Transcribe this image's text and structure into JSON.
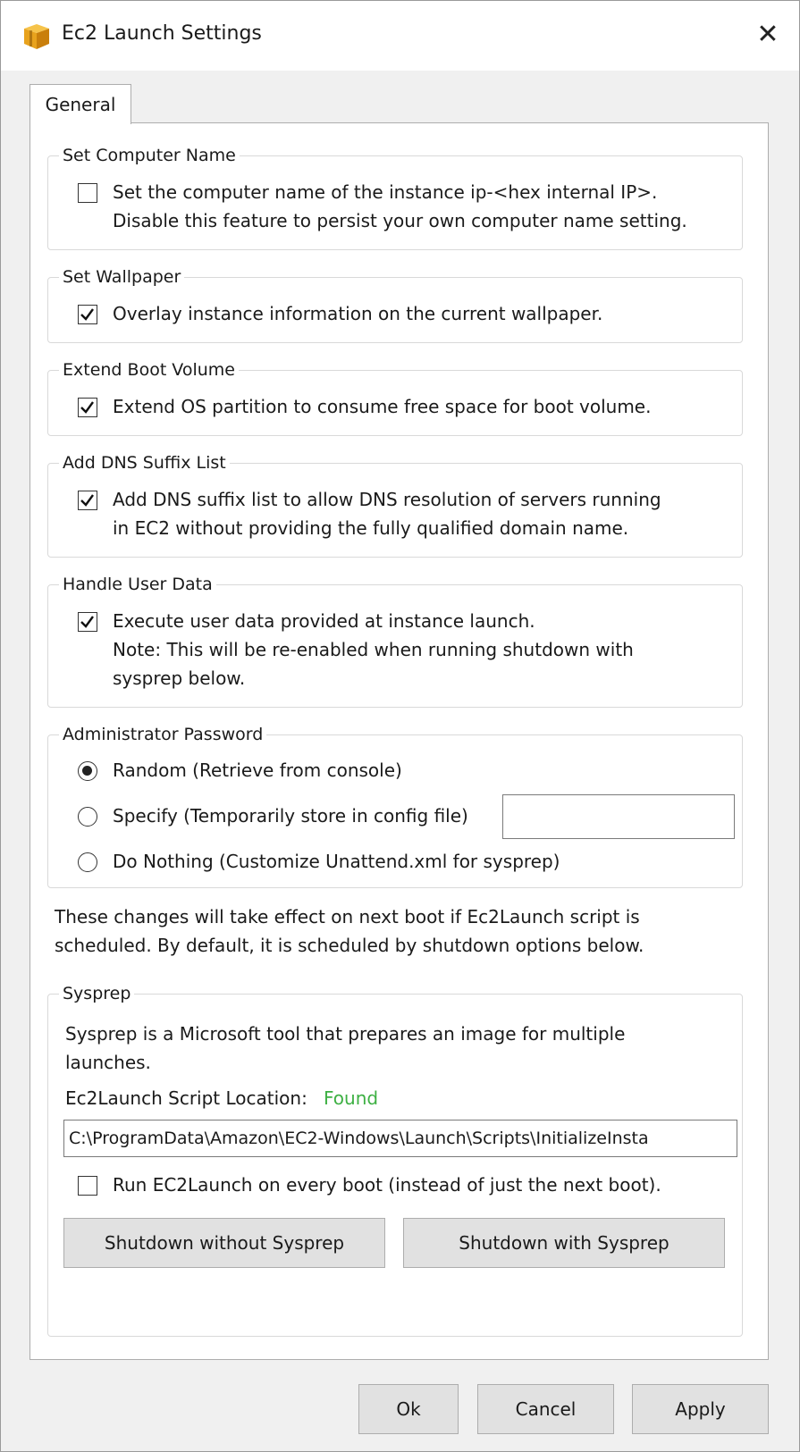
{
  "window": {
    "title": "Ec2 Launch Settings"
  },
  "tabs": [
    {
      "label": "General"
    }
  ],
  "groups": {
    "computer_name": {
      "legend": "Set Computer Name",
      "checked": false,
      "lines": [
        "Set the computer name of the instance ip-<hex internal IP>.",
        "Disable this feature to persist your own computer name setting."
      ]
    },
    "wallpaper": {
      "legend": "Set Wallpaper",
      "checked": true,
      "lines": [
        "Overlay instance information on the current wallpaper."
      ]
    },
    "boot_volume": {
      "legend": "Extend Boot Volume",
      "checked": true,
      "lines": [
        "Extend OS partition to consume free space for boot volume."
      ]
    },
    "dns_suffix": {
      "legend": "Add DNS Suffix List",
      "checked": true,
      "lines": [
        "Add DNS suffix list to allow DNS resolution of servers running",
        "in EC2 without providing the fully qualified domain name."
      ]
    },
    "user_data": {
      "legend": "Handle User Data",
      "checked": true,
      "lines": [
        "Execute user data provided at instance launch.",
        "Note: This will be re-enabled when running shutdown with",
        "sysprep below."
      ]
    },
    "admin_password": {
      "legend": "Administrator Password",
      "options": [
        {
          "label": "Random (Retrieve from console)",
          "selected": true
        },
        {
          "label": "Specify (Temporarily store in config file)",
          "selected": false
        },
        {
          "label": "Do Nothing (Customize Unattend.xml for sysprep)",
          "selected": false
        }
      ],
      "specify_value": ""
    }
  },
  "notice": [
    "These changes will take effect on next boot if Ec2Launch script is",
    "scheduled. By default, it is scheduled by shutdown options below."
  ],
  "sysprep": {
    "legend": "Sysprep",
    "description": [
      "Sysprep is a Microsoft tool that prepares an image for multiple",
      "launches."
    ],
    "location_label": "Ec2Launch Script Location:",
    "location_status": "Found",
    "location_status_color": "#3db043",
    "script_path": "C:\\ProgramData\\Amazon\\EC2-Windows\\Launch\\Scripts\\InitializeInsta",
    "every_boot_label": "Run EC2Launch on every boot (instead of just the next boot).",
    "every_boot_checked": false,
    "shutdown_without_label": "Shutdown without Sysprep",
    "shutdown_with_label": "Shutdown with Sysprep"
  },
  "footer": {
    "ok_label": "Ok",
    "cancel_label": "Cancel",
    "apply_label": "Apply"
  }
}
